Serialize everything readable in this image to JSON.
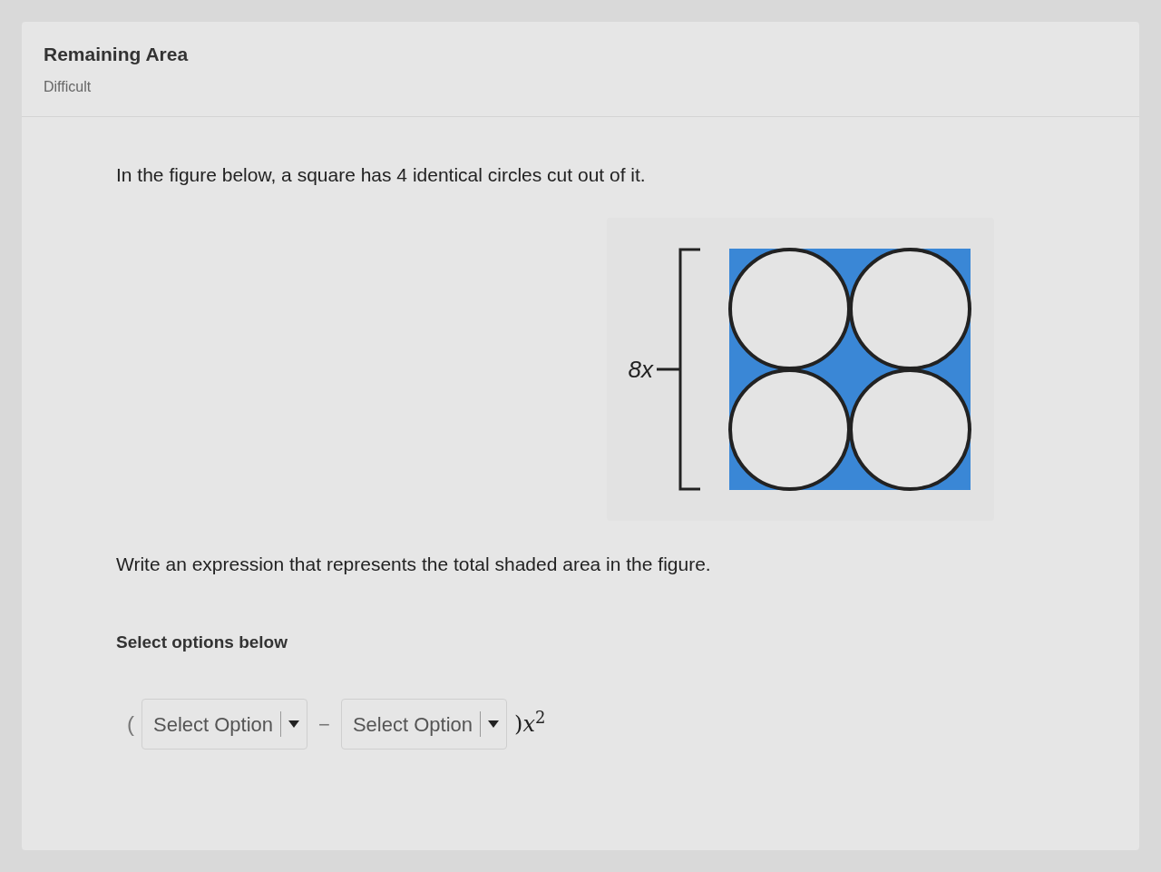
{
  "header": {
    "title": "Remaining Area",
    "difficulty": "Difficult"
  },
  "question": {
    "intro": "In the figure below, a square has 4 identical circles cut out of it.",
    "figure": {
      "side_label": "8x"
    },
    "prompt": "Write an expression that represents the total shaded area in the figure.",
    "instruction": "Select options below",
    "expression": {
      "open": "(",
      "operator": "−",
      "close": ")*x*$^{2}$",
      "selects": [
        {
          "value": "Select Option"
        },
        {
          "value": "Select Option"
        }
      ]
    }
  }
}
